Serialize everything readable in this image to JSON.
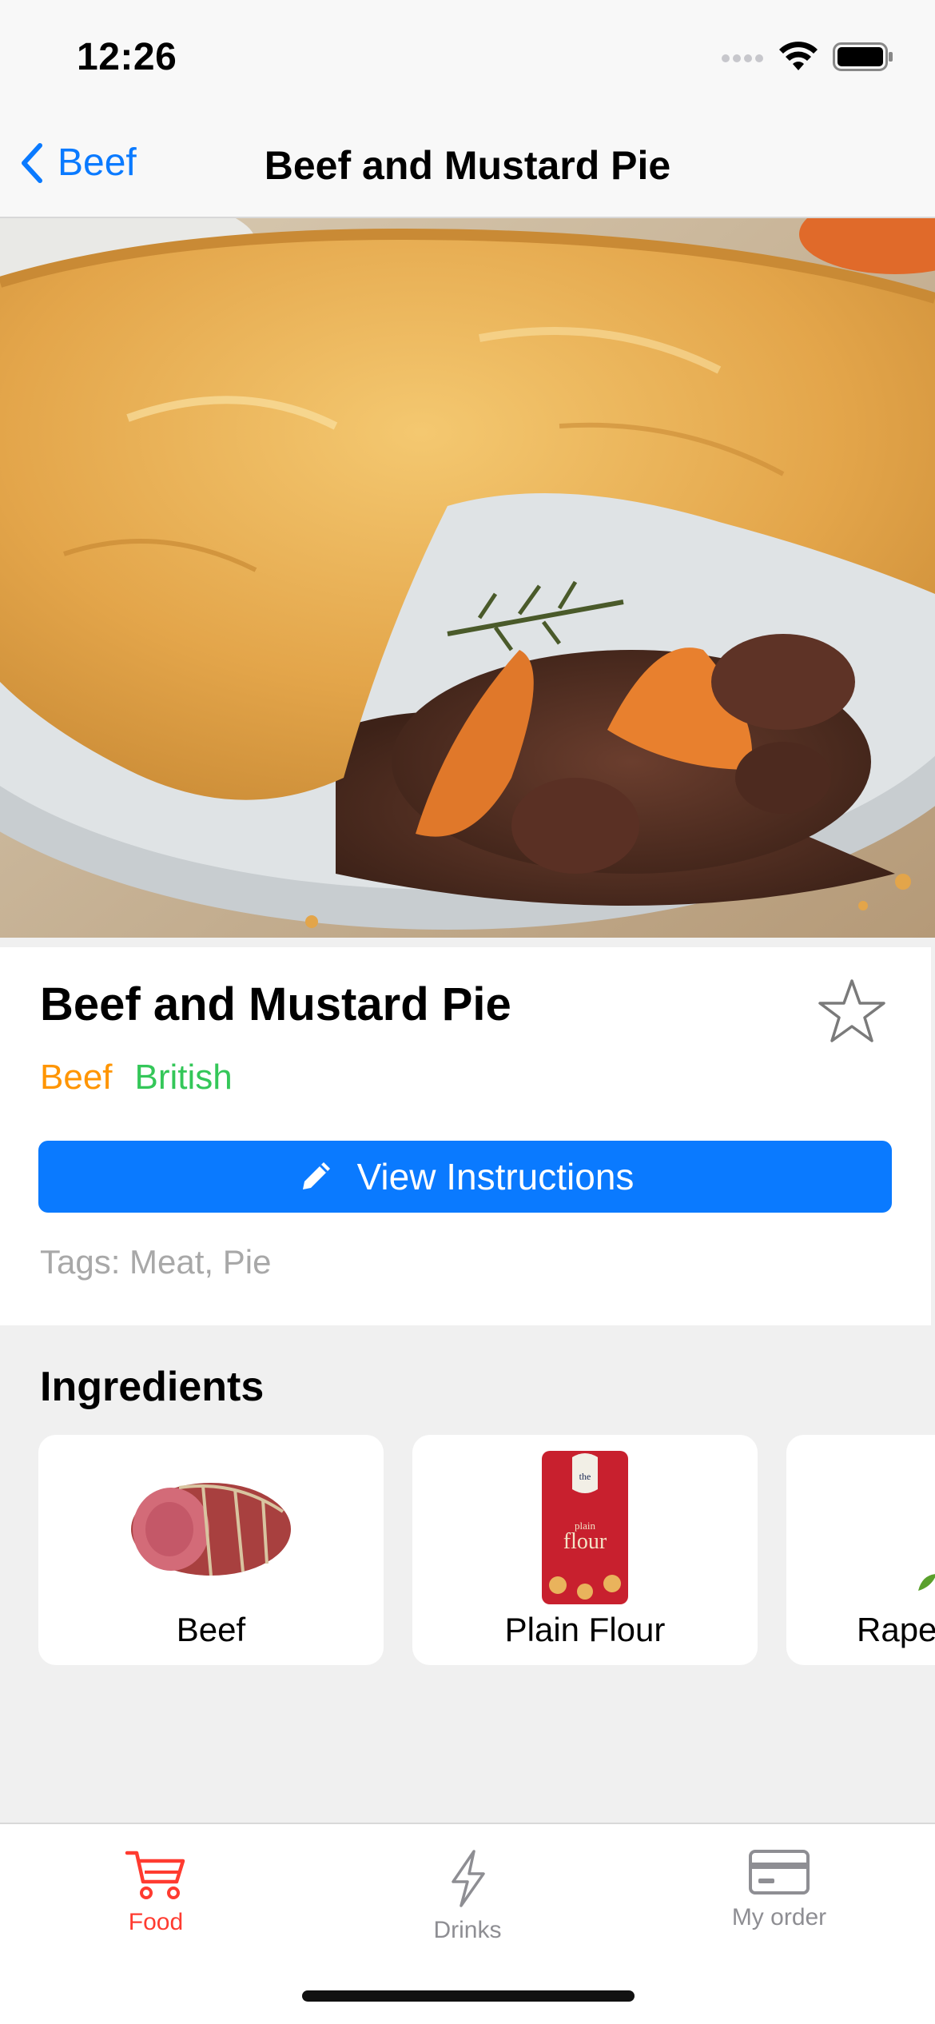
{
  "status_bar": {
    "time": "12:26"
  },
  "nav": {
    "back_label": "Beef",
    "title": "Beef and Mustard Pie"
  },
  "meal": {
    "name": "Beef and Mustard Pie",
    "category": "Beef",
    "area": "British",
    "instructions_button": "View Instructions",
    "tags": "Tags: Meat, Pie",
    "favorited": false
  },
  "ingredients": {
    "title": "Ingredients",
    "items": [
      {
        "name": "Beef",
        "icon": "beef-image"
      },
      {
        "name": "Plain Flour",
        "icon": "flour-bag-image"
      },
      {
        "name": "Rape",
        "icon": "rapeseed-image"
      }
    ]
  },
  "tab_bar": {
    "tabs": [
      {
        "label": "Food",
        "icon": "cart-icon",
        "active": true
      },
      {
        "label": "Drinks",
        "icon": "bolt-icon",
        "active": false
      },
      {
        "label": "My order",
        "icon": "card-icon",
        "active": false
      }
    ]
  },
  "colors": {
    "accent_blue": "#0a7aff",
    "category_orange": "#ff9500",
    "area_green": "#34c759",
    "tab_active_red": "#ff3b30",
    "tab_inactive_gray": "#8e8e93"
  }
}
